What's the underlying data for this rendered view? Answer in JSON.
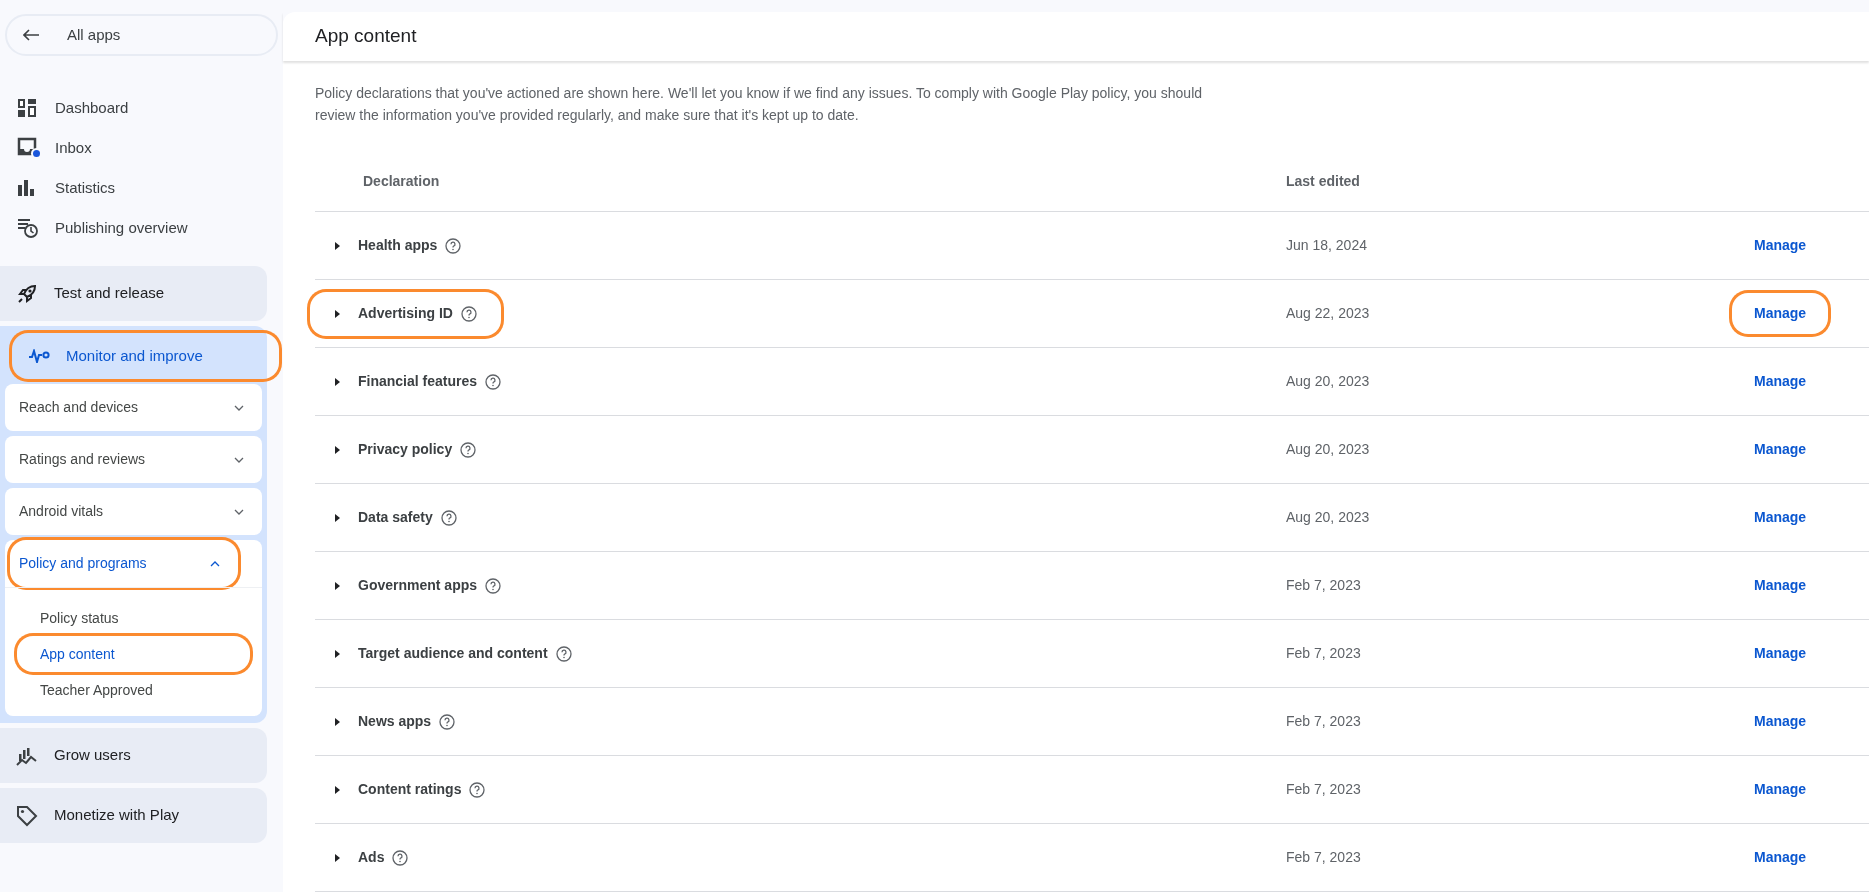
{
  "back_button": {
    "label": "All apps"
  },
  "nav": [
    {
      "label": "Dashboard"
    },
    {
      "label": "Inbox",
      "unread": true
    },
    {
      "label": "Statistics"
    },
    {
      "label": "Publishing overview"
    }
  ],
  "sections": [
    {
      "label": "Test and release",
      "selected": false,
      "highlighted": false
    },
    {
      "label": "Monitor and improve",
      "selected": true,
      "highlighted": true,
      "groups": [
        {
          "label": "Reach and devices",
          "expanded": false,
          "selected": false,
          "highlighted": false
        },
        {
          "label": "Ratings and reviews",
          "expanded": false,
          "selected": false,
          "highlighted": false
        },
        {
          "label": "Android vitals",
          "expanded": false,
          "selected": false,
          "highlighted": false
        },
        {
          "label": "Policy and programs",
          "expanded": true,
          "selected": true,
          "highlighted": true,
          "items": [
            {
              "label": "Policy status",
              "selected": false,
              "highlighted": false
            },
            {
              "label": "App content",
              "selected": true,
              "highlighted": true
            },
            {
              "label": "Teacher Approved",
              "selected": false,
              "highlighted": false
            }
          ]
        }
      ]
    },
    {
      "label": "Grow users",
      "selected": false,
      "highlighted": false
    },
    {
      "label": "Monetize with Play",
      "selected": false,
      "highlighted": false
    }
  ],
  "page": {
    "title": "App content",
    "description": "Policy declarations that you've actioned are shown here. We'll let you know if we find any issues. To comply with Google Play policy, you should review the information you've provided regularly, and make sure that it's kept up to date.",
    "table": {
      "columns": [
        "Declaration",
        "Last edited"
      ],
      "rows": [
        {
          "name": "Health apps",
          "date": "Jun 18, 2024",
          "action": "Manage",
          "highlighted": false
        },
        {
          "name": "Advertising ID",
          "date": "Aug 22, 2023",
          "action": "Manage",
          "highlighted": true
        },
        {
          "name": "Financial features",
          "date": "Aug 20, 2023",
          "action": "Manage",
          "highlighted": false
        },
        {
          "name": "Privacy policy",
          "date": "Aug 20, 2023",
          "action": "Manage",
          "highlighted": false
        },
        {
          "name": "Data safety",
          "date": "Aug 20, 2023",
          "action": "Manage",
          "highlighted": false
        },
        {
          "name": "Government apps",
          "date": "Feb 7, 2023",
          "action": "Manage",
          "highlighted": false
        },
        {
          "name": "Target audience and content",
          "date": "Feb 7, 2023",
          "action": "Manage",
          "highlighted": false
        },
        {
          "name": "News apps",
          "date": "Feb 7, 2023",
          "action": "Manage",
          "highlighted": false
        },
        {
          "name": "Content ratings",
          "date": "Feb 7, 2023",
          "action": "Manage",
          "highlighted": false
        },
        {
          "name": "Ads",
          "date": "Feb 7, 2023",
          "action": "Manage",
          "highlighted": false
        }
      ]
    }
  }
}
